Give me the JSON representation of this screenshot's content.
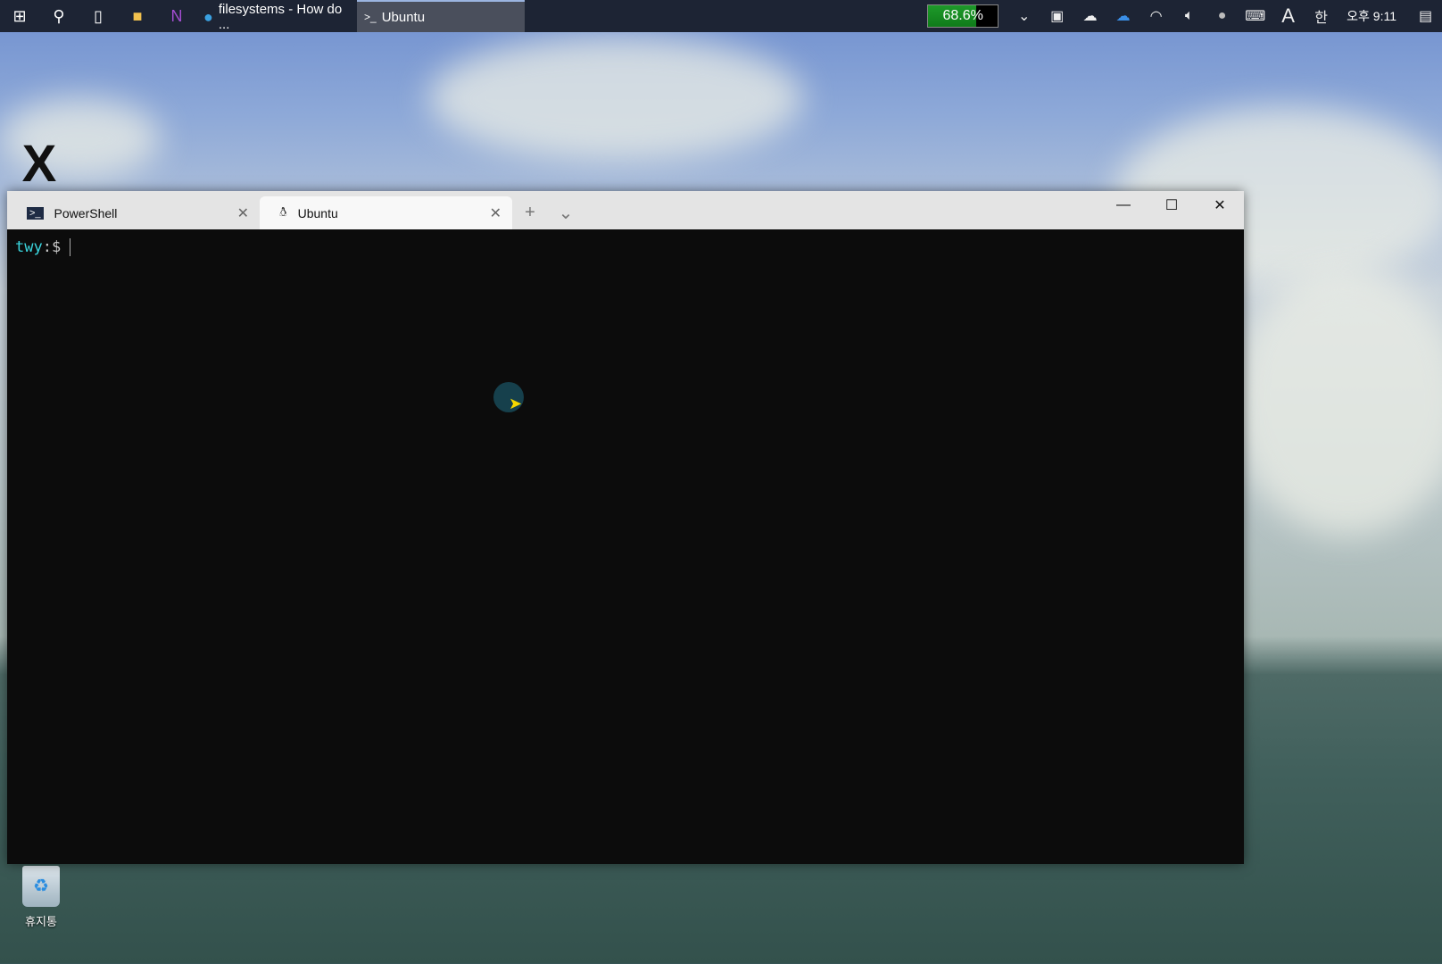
{
  "taskbar": {
    "apps": [
      {
        "label": "filesystems - How do ...",
        "icon": "edge-icon"
      },
      {
        "label": "Ubuntu",
        "icon": "terminal-icon",
        "active": true
      }
    ],
    "battery": {
      "label": "68.6%",
      "percent": 68.6
    },
    "clock": "오후 9:11",
    "ime_mode": "한",
    "font_mode": "A"
  },
  "desktop": {
    "recycle_bin": "휴지통"
  },
  "window": {
    "tabs": [
      {
        "label": "PowerShell"
      },
      {
        "label": "Ubuntu",
        "active": true
      }
    ],
    "terminal": {
      "prompt_user": "twy",
      "prompt_sep": ":$"
    }
  }
}
